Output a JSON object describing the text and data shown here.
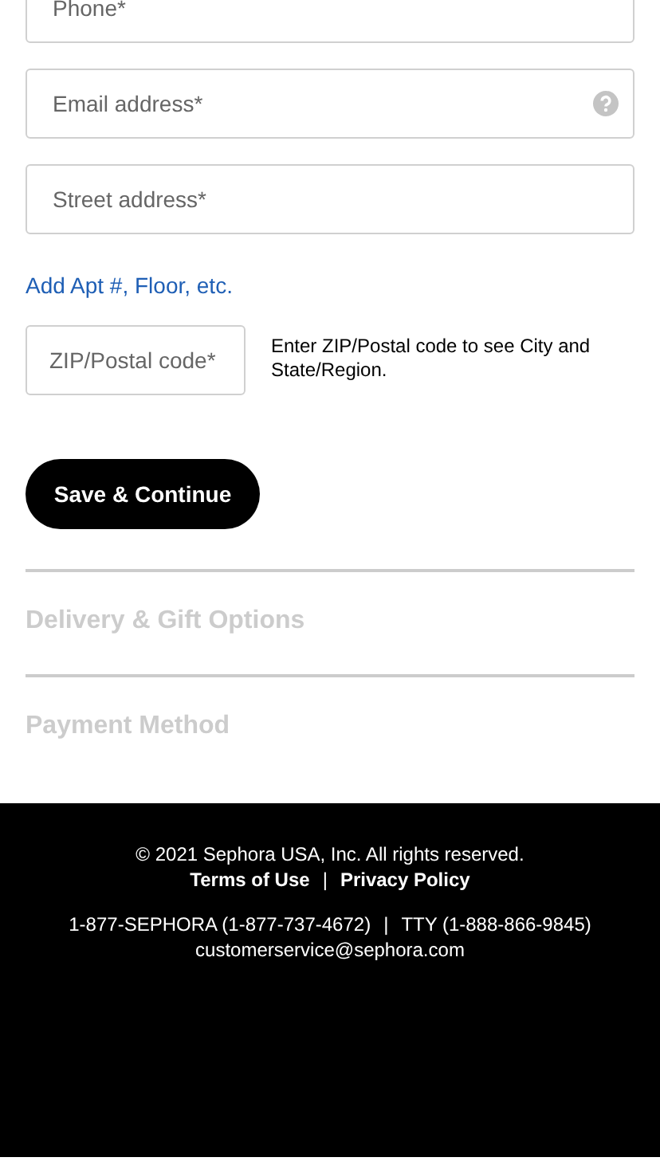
{
  "fields": [
    {
      "placeholder": "Phone*",
      "help": false
    },
    {
      "placeholder": "Email address*",
      "help": true
    },
    {
      "placeholder": "Street address*",
      "help": false
    }
  ],
  "add_link": "Add Apt #, Floor, etc.",
  "zip": {
    "placeholder": "ZIP/Postal code*",
    "hint": "Enter ZIP/Postal code to see City and State/Region."
  },
  "save_button": "Save & Continue",
  "sections": [
    {
      "title": "Delivery & Gift Options",
      "disabled": true
    },
    {
      "title": "Payment Method",
      "disabled": true
    }
  ],
  "footer": {
    "copyright": "© 2021 Sephora USA, Inc. All rights reserved.",
    "links": [
      "Terms of Use",
      "|",
      "Privacy Policy"
    ],
    "contacts": [
      "1-877-SEPHORA (1-877-737-4672)",
      "|",
      "TTY (1-888-866-9845)"
    ],
    "email": "customerservice@sephora.com"
  }
}
